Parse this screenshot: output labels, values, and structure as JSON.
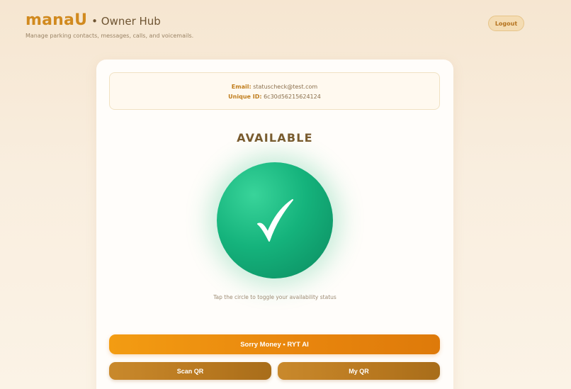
{
  "header": {
    "brand": "manaU",
    "hub_title": "• Owner Hub",
    "subtitle": "Manage parking contacts, messages, calls, and voicemails.",
    "logout_label": "Logout"
  },
  "account": {
    "email_label": "Email:",
    "email_value": "statuscheck@test.com",
    "uid_label": "Unique ID:",
    "uid_value": "6c30d56215624124"
  },
  "status": {
    "title": "AVAILABLE",
    "icon": "checkmark-icon",
    "color": "#15b37c",
    "hint": "Tap the circle to toggle your availability status"
  },
  "actions": {
    "primary_label": "Sorry Money • RYT AI",
    "scan_label": "Scan QR",
    "myqr_label": "My QR"
  }
}
